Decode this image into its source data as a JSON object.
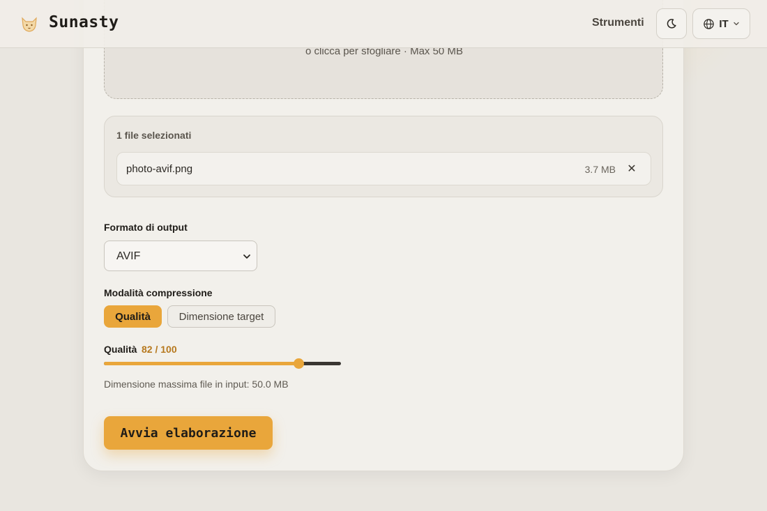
{
  "header": {
    "brand": "Sunasty",
    "nav_tools": "Strumenti",
    "theme_icon": "moon-icon",
    "language_icon": "globe-icon",
    "language_code": "IT"
  },
  "upload": {
    "drop_hint": "o clicca per sfogliare · Max 50 MB"
  },
  "files": {
    "title": "1 file selezionati",
    "items": [
      {
        "name": "photo-avif.png",
        "size": "3.7 MB",
        "remove_symbol": "✕"
      }
    ]
  },
  "output": {
    "label": "Formato di output",
    "selected": "AVIF"
  },
  "compression": {
    "label": "Modalità compressione",
    "modes": [
      "Qualità",
      "Dimensione target"
    ],
    "active_mode": "Qualità"
  },
  "quality": {
    "label": "Qualità",
    "value_text": "82 / 100",
    "value": 82,
    "max": 100
  },
  "limits": {
    "hint": "Dimensione massima file in input: 50.0 MB"
  },
  "actions": {
    "run_label": "Avvia elaborazione"
  },
  "colors": {
    "accent": "#e9a63b",
    "accent_text": "#b6781d"
  }
}
